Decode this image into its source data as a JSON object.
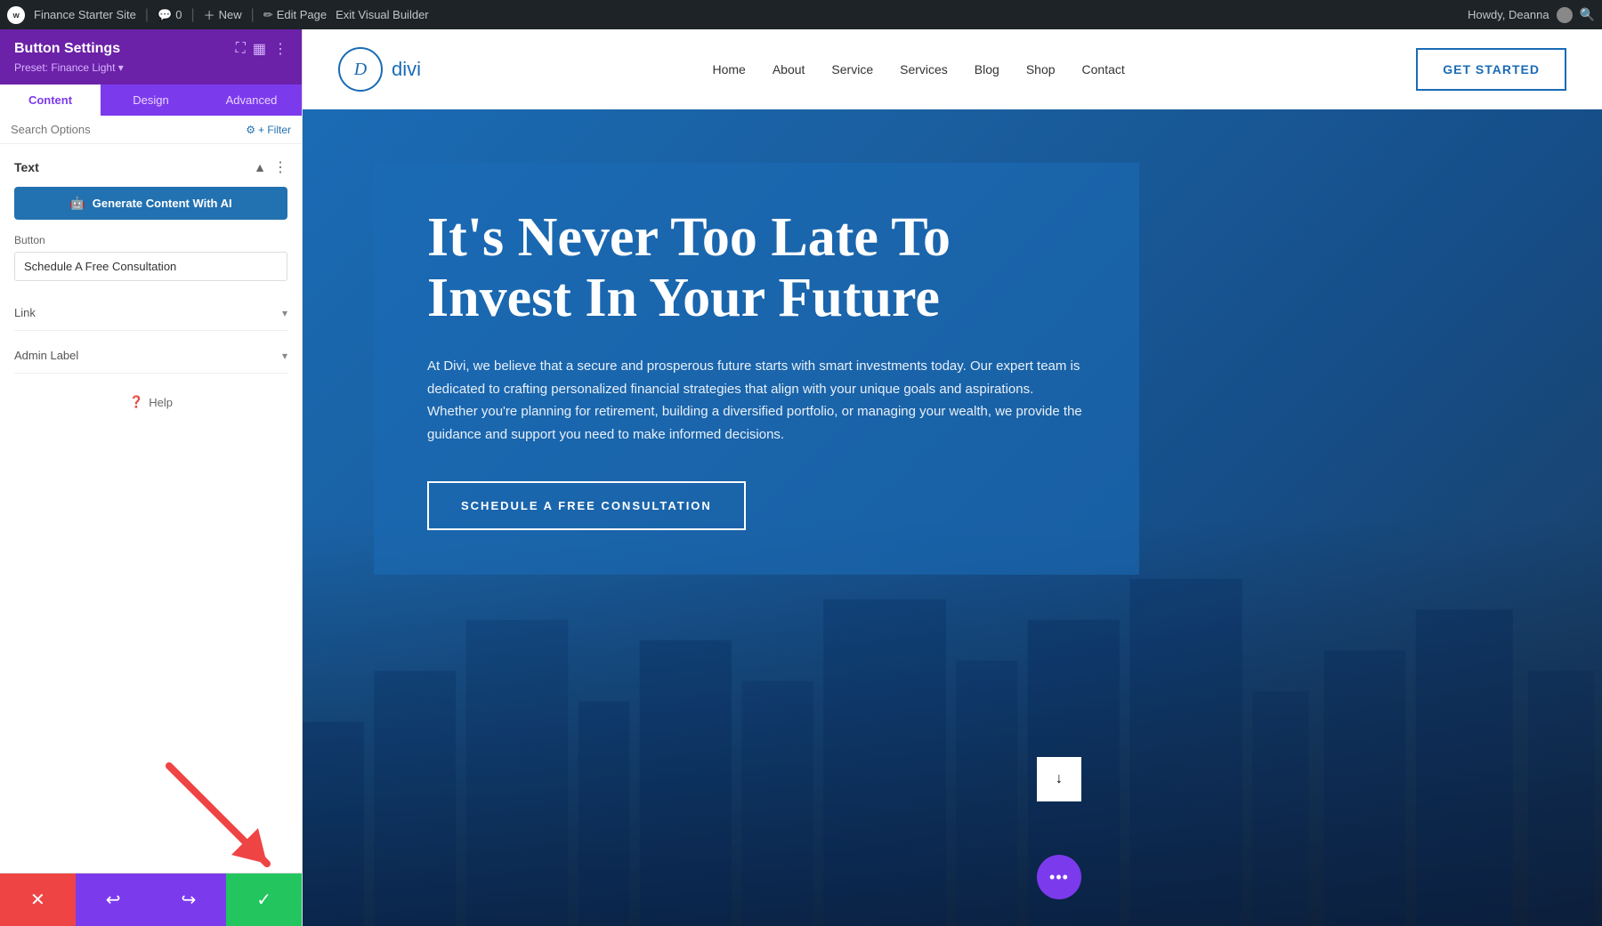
{
  "admin_bar": {
    "site_name": "Finance Starter Site",
    "comments_count": "0",
    "new_label": "New",
    "edit_page_label": "Edit Page",
    "exit_builder_label": "Exit Visual Builder",
    "howdy": "Howdy, Deanna"
  },
  "left_panel": {
    "title": "Button Settings",
    "preset": "Preset: Finance Light ▾",
    "tabs": {
      "content": "Content",
      "design": "Design",
      "advanced": "Advanced"
    },
    "search_placeholder": "Search Options",
    "filter_label": "+ Filter",
    "text_section": {
      "title": "Text",
      "ai_button_label": "Generate Content With AI"
    },
    "button_section": {
      "title": "Button",
      "input_value": "Schedule A Free Consultation"
    },
    "link_section": {
      "title": "Link"
    },
    "admin_label_section": {
      "title": "Admin Label"
    },
    "help_label": "Help",
    "bottom_bar": {
      "cancel_icon": "✕",
      "undo_icon": "↩",
      "redo_icon": "↪",
      "save_icon": "✓"
    }
  },
  "site_nav": {
    "logo_letter": "D",
    "logo_name": "divi",
    "links": [
      "Home",
      "About",
      "Service",
      "Services",
      "Blog",
      "Shop",
      "Contact"
    ],
    "cta_label": "GET STARTED"
  },
  "hero": {
    "title": "It's Never Too Late To Invest In Your Future",
    "description": "At Divi, we believe that a secure and prosperous future starts with smart investments today. Our expert team is dedicated to crafting personalized financial strategies that align with your unique goals and aspirations. Whether you're planning for retirement, building a diversified portfolio, or managing your wealth, we provide the guidance and support you need to make informed decisions.",
    "cta_label": "SCHEDULE A FREE CONSULTATION"
  }
}
